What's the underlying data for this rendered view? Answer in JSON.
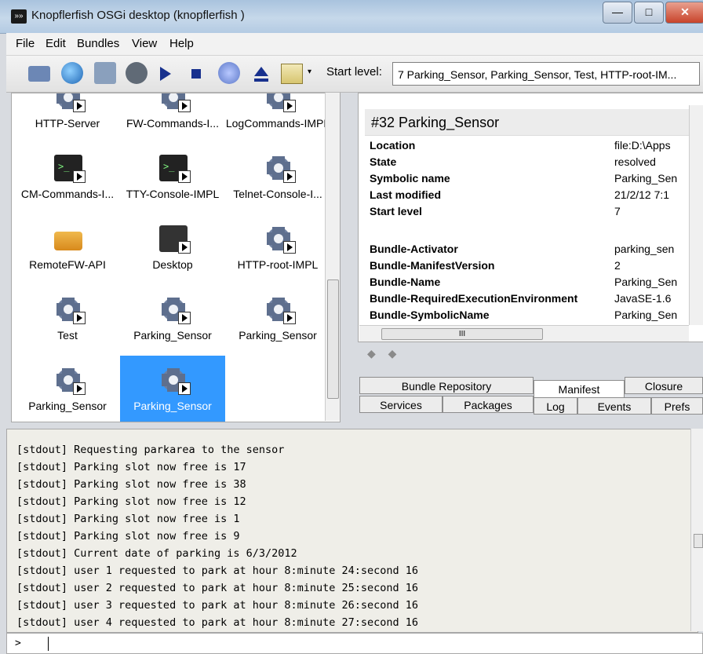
{
  "window": {
    "title": "Knopflerfish OSGi desktop (knopflerfish )",
    "app_icon_text": "»»",
    "min_glyph": "—",
    "max_glyph": "□",
    "close_glyph": "✕"
  },
  "menu": [
    "File",
    "Edit",
    "Bundles",
    "View",
    "Help"
  ],
  "toolbar": {
    "icons": [
      "open-bundle-icon",
      "install-url-icon",
      "update-bundle-icon",
      "uninstall-bundle-icon",
      "start-bundle-icon",
      "stop-bundle-icon",
      "refresh-icon",
      "eject-icon",
      "list-icon"
    ],
    "dropdown_glyph": "▾",
    "start_level_label": "Start level:",
    "start_level_value": "7 Parking_Sensor, Parking_Sensor, Test, HTTP-root-IM..."
  },
  "bundles": [
    {
      "label": "HTTP-Server",
      "icon": "gear-icon"
    },
    {
      "label": "FW-Commands-I...",
      "icon": "gear-icon"
    },
    {
      "label": "LogCommands-IMPL",
      "icon": "gear-icon"
    },
    {
      "label": "CM-Commands-I...",
      "icon": "terminal-icon"
    },
    {
      "label": "TTY-Console-IMPL",
      "icon": "terminal-icon"
    },
    {
      "label": "Telnet-Console-I...",
      "icon": "gear-icon"
    },
    {
      "label": "RemoteFW-API",
      "icon": "package-icon"
    },
    {
      "label": "Desktop",
      "icon": "speaker-icon"
    },
    {
      "label": "HTTP-root-IMPL",
      "icon": "gear-icon"
    },
    {
      "label": "Test",
      "icon": "gear-icon"
    },
    {
      "label": "Parking_Sensor",
      "icon": "gear-icon"
    },
    {
      "label": "Parking_Sensor",
      "icon": "gear-icon"
    },
    {
      "label": "Parking_Sensor",
      "icon": "gear-icon"
    },
    {
      "label": "Parking_Sensor",
      "icon": "gear-icon",
      "selected": true
    }
  ],
  "details": {
    "title": "#32 Parking_Sensor",
    "properties": [
      {
        "key": "Location",
        "value": "file:D:\\Apps"
      },
      {
        "key": "State",
        "value": "resolved"
      },
      {
        "key": "Symbolic name",
        "value": "Parking_Sen"
      },
      {
        "key": "Last modified",
        "value": "21/2/12 7:1"
      },
      {
        "key": "Start level",
        "value": "7"
      }
    ],
    "manifest": [
      {
        "key": "Bundle-Activator",
        "value": "parking_sen"
      },
      {
        "key": "Bundle-ManifestVersion",
        "value": "2"
      },
      {
        "key": "Bundle-Name",
        "value": "Parking_Sen"
      },
      {
        "key": "Bundle-RequiredExecutionEnvironment",
        "value": "JavaSE-1.6"
      },
      {
        "key": "Bundle-SymbolicName",
        "value": "Parking_Sen"
      }
    ],
    "hscroll_grip": "III",
    "nav_arrows": "◆ ◆"
  },
  "tabs_top": [
    "Bundle Repository",
    "Manifest",
    "Closure"
  ],
  "tabs_bottom": [
    "Services",
    "Packages",
    "Log",
    "Events",
    "Prefs"
  ],
  "console": {
    "lines": [
      "[stdout] Requesting parkarea to the sensor",
      "[stdout] Parking slot now free is 17",
      "[stdout] Parking slot now free is 38",
      "[stdout] Parking slot now free is 12",
      "[stdout] Parking slot now free is 1",
      "[stdout] Parking slot now free is 9",
      "[stdout] Current date of parking is 6/3/2012",
      "[stdout] user 1 requested to park at hour 8:minute 24:second 16",
      "[stdout] user 2 requested to park at hour 8:minute 25:second 16",
      "[stdout] user 3 requested to park at hour 8:minute 26:second 16",
      "[stdout] user 4 requested to park at hour 8:minute 27:second 16"
    ],
    "prompt": ">"
  }
}
